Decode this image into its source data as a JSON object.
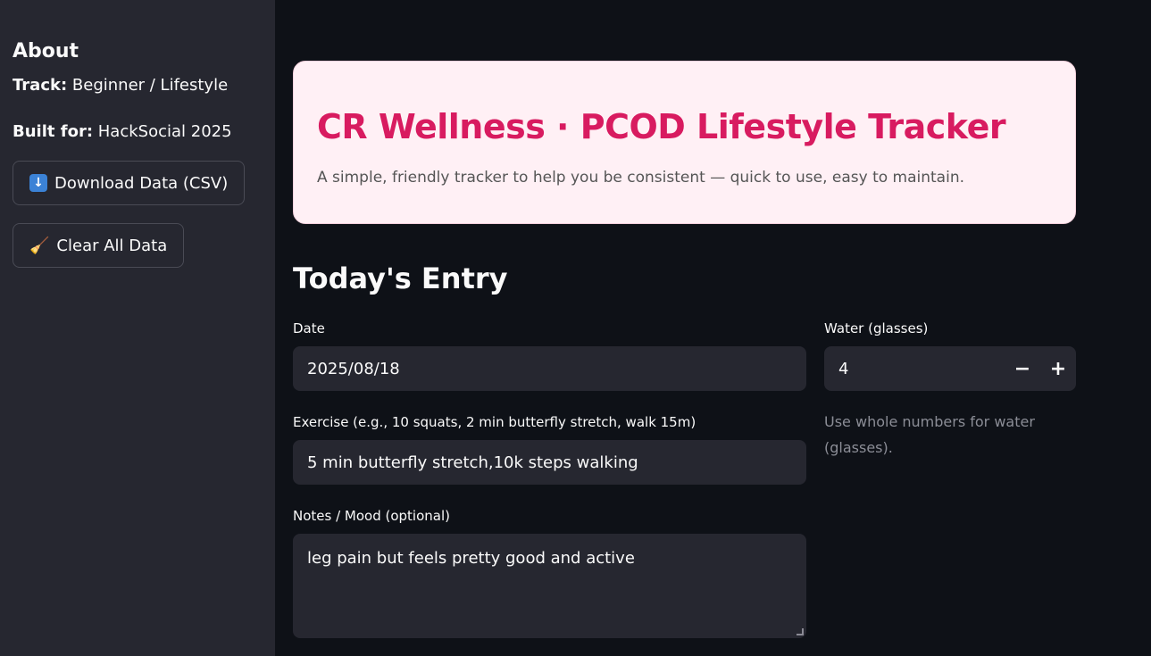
{
  "sidebar": {
    "heading": "About",
    "track_label": "Track:",
    "track_value": "Beginner / Lifestyle",
    "built_label": "Built for:",
    "built_value": "HackSocial 2025",
    "download_button": {
      "icon": "download-arrow-icon",
      "label": "Download Data (CSV)"
    },
    "clear_button": {
      "icon": "broom-icon",
      "label": "Clear All Data"
    }
  },
  "hero": {
    "title": "CR Wellness · PCOD Lifestyle Tracker",
    "subtitle": "A simple, friendly tracker to help you be consistent — quick to use, easy to maintain.",
    "title_color": "#d81b60",
    "background_color": "#fff0f5"
  },
  "entry": {
    "section_title": "Today's Entry",
    "date": {
      "label": "Date",
      "value": "2025/08/18"
    },
    "water": {
      "label": "Water (glasses)",
      "value": "4",
      "minus": "−",
      "plus": "+",
      "help": "Use whole numbers for water (glasses)."
    },
    "exercise": {
      "label": "Exercise (e.g., 10 squats, 2 min butterfly stretch, walk 15m)",
      "value": "5 min butterfly stretch,10k steps walking"
    },
    "notes": {
      "label": "Notes / Mood (optional)",
      "value": "leg pain but feels pretty good and active"
    }
  }
}
